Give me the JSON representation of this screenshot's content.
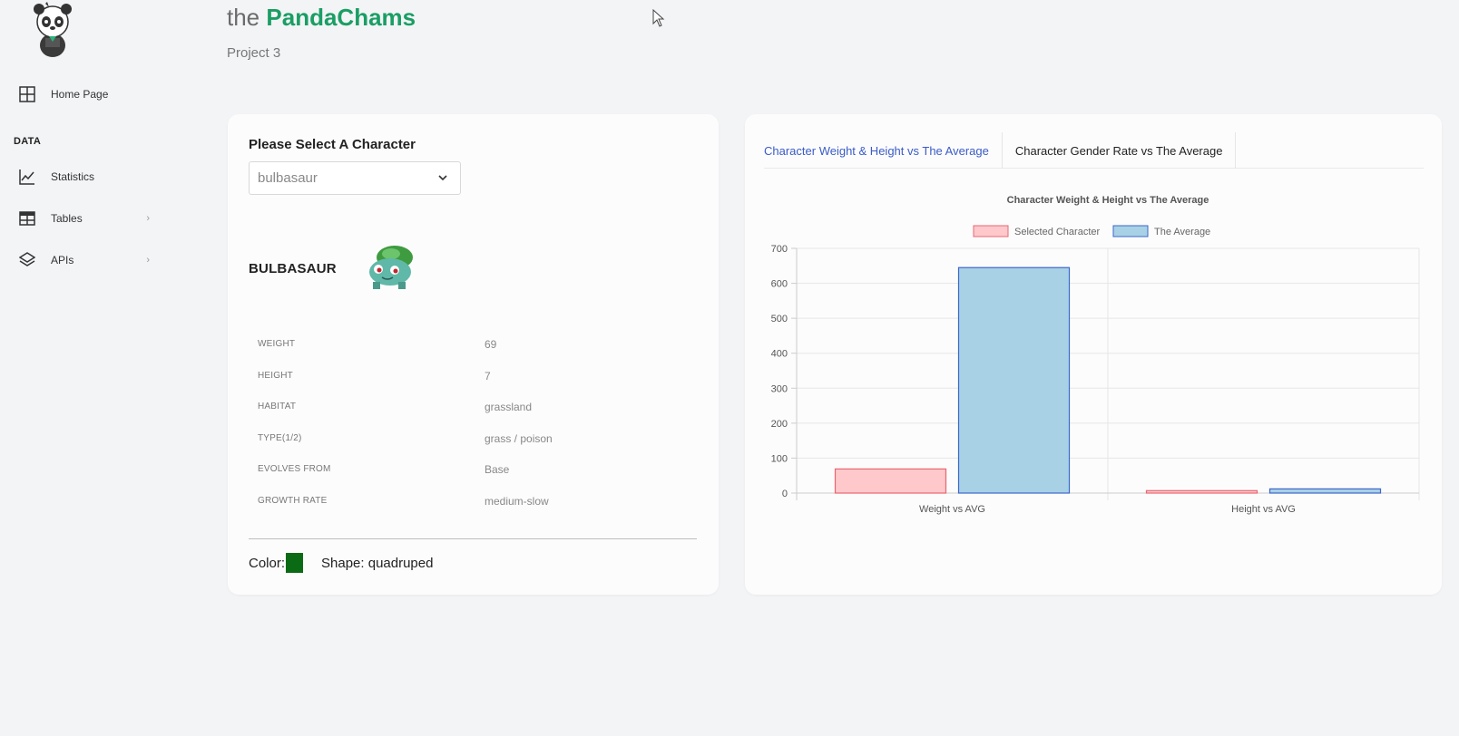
{
  "app": {
    "brand_prefix": "the",
    "brand_name": "PandaChams",
    "subtitle": "Project 3"
  },
  "sidebar": {
    "items": [
      {
        "label": "Home Page",
        "icon": "grid-icon"
      },
      {
        "label": "Statistics",
        "icon": "line-chart-icon"
      },
      {
        "label": "Tables",
        "icon": "table-icon",
        "chevron": "›"
      },
      {
        "label": "APIs",
        "icon": "layers-icon",
        "chevron": "›"
      }
    ],
    "section_label": "DATA"
  },
  "selector": {
    "title": "Please Select A Character",
    "selected": "bulbasaur"
  },
  "character": {
    "name": "BULBASAUR",
    "stats": [
      {
        "key": "WEIGHT",
        "value": "69"
      },
      {
        "key": "HEIGHT",
        "value": "7"
      },
      {
        "key": "HABITAT",
        "value": "grassland"
      },
      {
        "key": "TYPE(1/2)",
        "value": "grass / poison"
      },
      {
        "key": "EVOLVES FROM",
        "value": "Base"
      },
      {
        "key": "GROWTH RATE",
        "value": "medium-slow"
      }
    ],
    "color_label": "Color:",
    "color_value": "#0b6b14",
    "shape_label": "Shape: quadruped"
  },
  "tabs": [
    {
      "label": "Character Weight & Height vs The Average",
      "active": true
    },
    {
      "label": "Character Gender Rate vs The Average",
      "active": false
    }
  ],
  "colors": {
    "accent": "#1a9e64",
    "tab_active": "#3a5cc7",
    "selected_fill": "#ffc9cc",
    "selected_stroke": "#e8666f",
    "average_fill": "#a8d1e6",
    "average_stroke": "#3d66cc"
  },
  "chart_data": {
    "type": "bar",
    "title": "Character Weight & Height vs The Average",
    "categories": [
      "Weight vs AVG",
      "Height vs AVG"
    ],
    "series": [
      {
        "name": "Selected Character",
        "values": [
          69,
          7
        ]
      },
      {
        "name": "The Average",
        "values": [
          645,
          12
        ]
      }
    ],
    "ylim": [
      0,
      700
    ],
    "yticks": [
      0,
      100,
      200,
      300,
      400,
      500,
      600,
      700
    ],
    "legend": "top",
    "grid": true
  }
}
